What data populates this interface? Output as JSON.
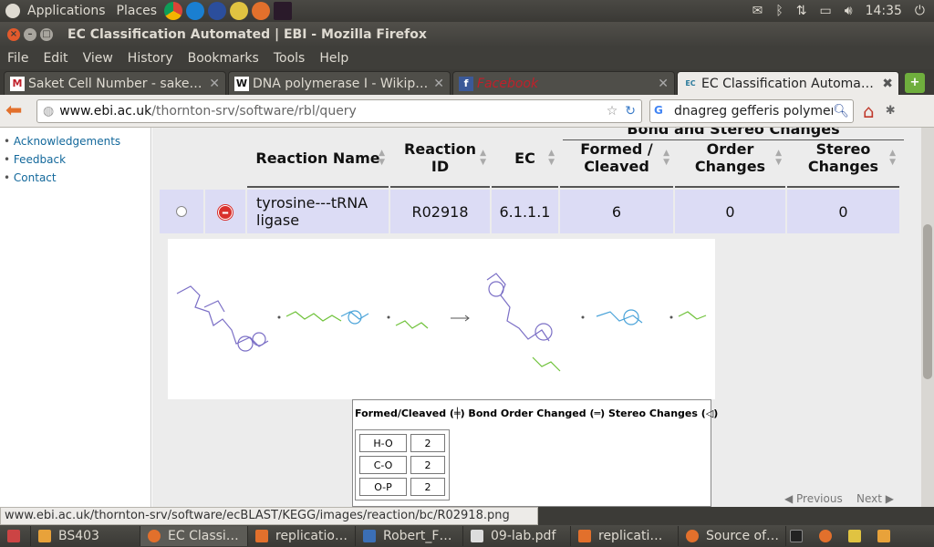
{
  "top_panel": {
    "applications": "Applications",
    "places": "Places",
    "clock": "14:35"
  },
  "window": {
    "title": "EC Classification Automated | EBI - Mozilla Firefox"
  },
  "menubar": [
    "File",
    "Edit",
    "View",
    "History",
    "Bookmarks",
    "Tools",
    "Help"
  ],
  "tabs": [
    {
      "label": "Saket Cell Number - saketk…",
      "fav": "M"
    },
    {
      "label": "DNA polymerase I - Wikipe…",
      "fav": "W"
    },
    {
      "label": "Facebook",
      "fav": "f"
    },
    {
      "label": "EC Classification Automate…",
      "fav": "EC"
    }
  ],
  "navbar": {
    "url_host": "www.ebi.ac.uk",
    "url_path": "/thornton-srv/software/rbl/query",
    "search_value": "dnagreg gefferis polymer"
  },
  "sidebar": {
    "links": [
      "Acknowledgements",
      "Feedback",
      "Contact"
    ]
  },
  "results": {
    "group_header": "Bond and Stereo Changes",
    "columns": {
      "reaction_name": "Reaction Name",
      "reaction_id": "Reaction ID",
      "ec": "EC",
      "formed": "Formed / Cleaved",
      "order": "Order Changes",
      "stereo": "Stereo Changes"
    },
    "row": {
      "reaction_name": "tyrosine---tRNA ligase",
      "reaction_id": "R02918",
      "ec": "6.1.1.1",
      "formed": "6",
      "order": "0",
      "stereo": "0"
    }
  },
  "legend": {
    "formed": "Formed/Cleaved (",
    "order": ") Bond Order Changed (",
    "stereo": ") Stereo Changes (",
    "close": ")",
    "changes": [
      {
        "bond": "H-O",
        "count": "2"
      },
      {
        "bond": "C-O",
        "count": "2"
      },
      {
        "bond": "O-P",
        "count": "2"
      }
    ]
  },
  "pager": {
    "previous": "Previous",
    "next": "Next"
  },
  "statusbar": {
    "text": "www.ebi.ac.uk/thornton-srv/software/ecBLAST/KEGG/images/reaction/bc/R02918.png"
  },
  "taskbar": [
    {
      "label": "BS403",
      "color": "#e8a23a"
    },
    {
      "label": "EC Classi…",
      "color": "#e2702c",
      "active": true
    },
    {
      "label": "replicatio…",
      "color": "#e2702c"
    },
    {
      "label": "Robert_F…",
      "color": "#3b6fb6"
    },
    {
      "label": "09-lab.pdf",
      "color": "#dddddd"
    },
    {
      "label": "replicati…",
      "color": "#e2702c"
    },
    {
      "label": "Source of…",
      "color": "#e2702c"
    }
  ],
  "colors": {
    "row_bg": "#dcdcf5",
    "link": "#13689b",
    "facebook_red": "#c0202a"
  }
}
